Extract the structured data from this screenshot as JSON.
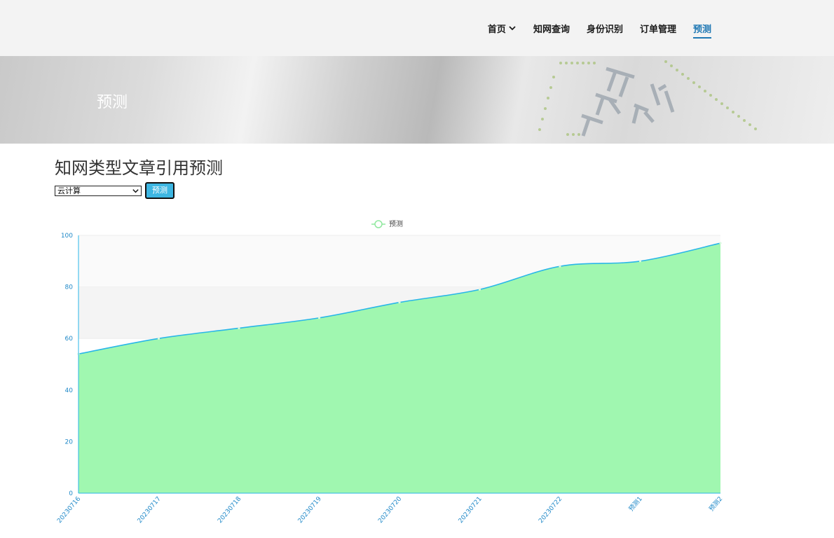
{
  "nav": {
    "items": [
      {
        "label": "首页",
        "has_dropdown": true,
        "active": false
      },
      {
        "label": "知网查询",
        "active": false
      },
      {
        "label": "身份识别",
        "active": false
      },
      {
        "label": "订单管理",
        "active": false
      },
      {
        "label": "预测",
        "active": true
      }
    ],
    "active_color": "#1f78b4"
  },
  "banner": {
    "title": "预测"
  },
  "main": {
    "heading": "知网类型文章引用预测",
    "select_value": "云计算",
    "button_label": "预测"
  },
  "chart_data": {
    "type": "area",
    "legend": [
      "预测"
    ],
    "legend_placement": "top-center",
    "categories": [
      "20230716",
      "20230717",
      "20230718",
      "20230719",
      "20230720",
      "20230721",
      "20230722",
      "预测1",
      "预测2"
    ],
    "series": [
      {
        "name": "预测",
        "values": [
          54,
          60,
          64,
          68,
          74,
          79,
          88,
          90,
          97
        ],
        "line_color": "#29b6e8",
        "fill_color": "#a0f7b0"
      }
    ],
    "ylim": [
      0,
      100
    ],
    "yticks": [
      0,
      20,
      40,
      60,
      80,
      100
    ],
    "grid": true
  }
}
